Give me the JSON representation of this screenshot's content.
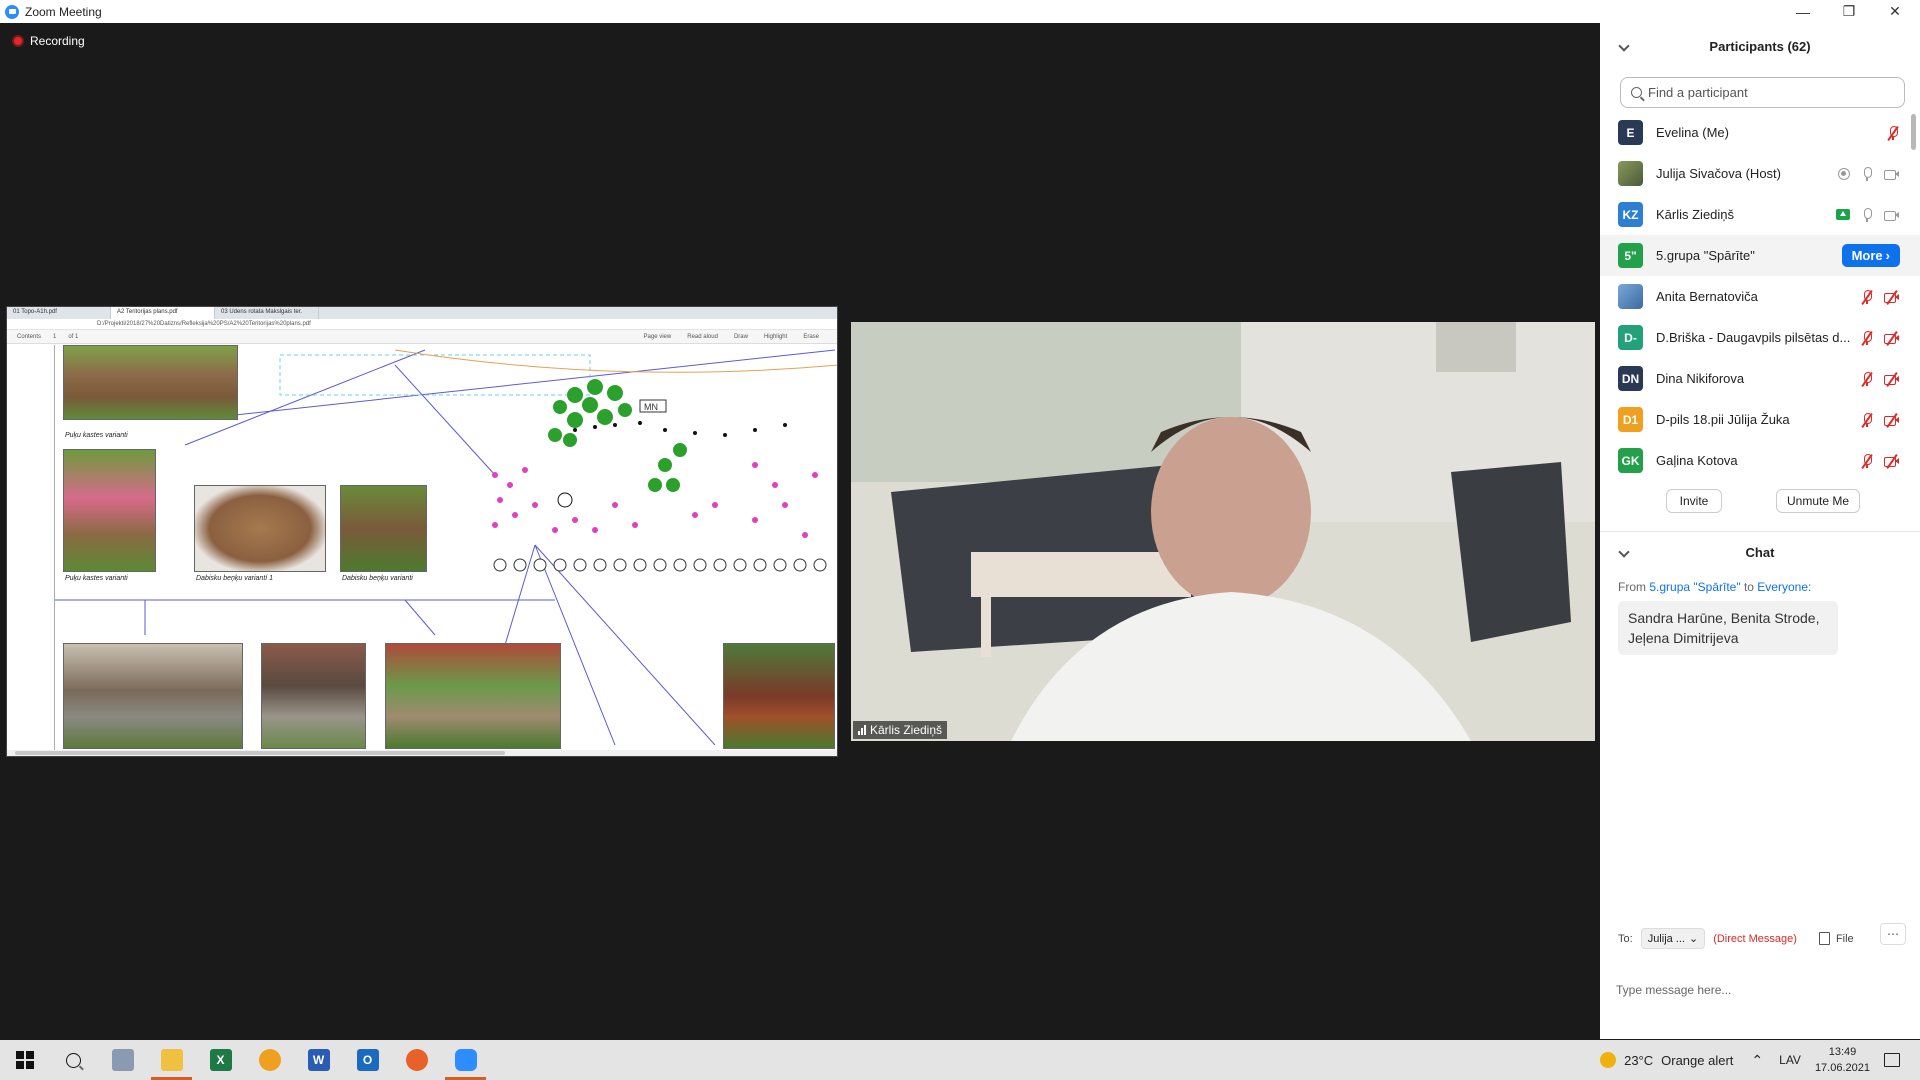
{
  "window": {
    "title": "Zoom Meeting"
  },
  "recording": {
    "label": "Recording"
  },
  "shared_screen": {
    "tabs": [
      "01 Topo-A1h.pdf",
      "A2 Teritorijas plans.pdf",
      "03 Udens rotata Makslgais ter."
    ],
    "address": "D:/Projekti/2018/27%20Datizns/Refleksija%20PS/A2%20Teritorijas%20plans.pdf",
    "toolbar": {
      "contents": "Contents",
      "page": "1",
      "of": "of 1",
      "page_view": "Page view",
      "read_aloud": "Read aloud",
      "draw": "Draw",
      "highlight": "Highlight",
      "erase": "Erase"
    },
    "captions": {
      "flower_log_1": "Puķu kastes varianti",
      "flower_log_2": "Puķu kastes varianti",
      "bench_1": "Dabisku beņķu variantí 1",
      "bench_2": "Dabisku beņķu varianti"
    },
    "plan_labels": {
      "mn": "MN"
    }
  },
  "video": {
    "participant_name": "Kārlis Ziediņš"
  },
  "participants_panel": {
    "header": "Participants (62)",
    "search_placeholder": "Find a participant",
    "participants": [
      {
        "initials": "E",
        "name": "Evelina (Me)",
        "color": "#2a3a55"
      },
      {
        "initials": "",
        "name": "Julija Sivačova (Host)",
        "color": "#6b7a4a"
      },
      {
        "initials": "KZ",
        "name": "Kārlis Ziediņš",
        "color": "#2d7fd3"
      },
      {
        "initials": "5\"",
        "name": "5.grupa \"Spārīte\"",
        "color": "#23a14a"
      },
      {
        "initials": "",
        "name": "Anita Bernatoviča",
        "color": "#5a8fc4"
      },
      {
        "initials": "D-",
        "name": "D.Briška - Daugavpils pilsētas d...",
        "color": "#23a17a"
      },
      {
        "initials": "DN",
        "name": "Dina Nikiforova",
        "color": "#2a3a55"
      },
      {
        "initials": "D1",
        "name": "D-pils 18.pii Jūlija Žuka",
        "color": "#f0a020"
      },
      {
        "initials": "GK",
        "name": "Gaļina Kotova",
        "color": "#23a14a"
      }
    ],
    "more_button": "More",
    "invite_button": "Invite",
    "unmute_button": "Unmute Me"
  },
  "chat": {
    "header": "Chat",
    "from_prefix": "From",
    "from_name": "5.grupa \"Spārīte\"",
    "to_word": "to",
    "to_name": "Everyone:",
    "message": "Sandra Harūne, Benita Strode, Jeļena Dimitrijeva",
    "to_label": "To:",
    "recipient": "Julija ...",
    "direct_message": "(Direct Message)",
    "file_label": "File",
    "input_placeholder": "Type message here..."
  },
  "taskbar": {
    "weather": "23°C",
    "alert": "Orange alert",
    "language": "LAV",
    "time": "13:49",
    "date": "17.06.2021"
  },
  "colors": {
    "accent": "#0e72ed",
    "muted": "#e02828",
    "zoom_blue": "#2d8cff"
  }
}
